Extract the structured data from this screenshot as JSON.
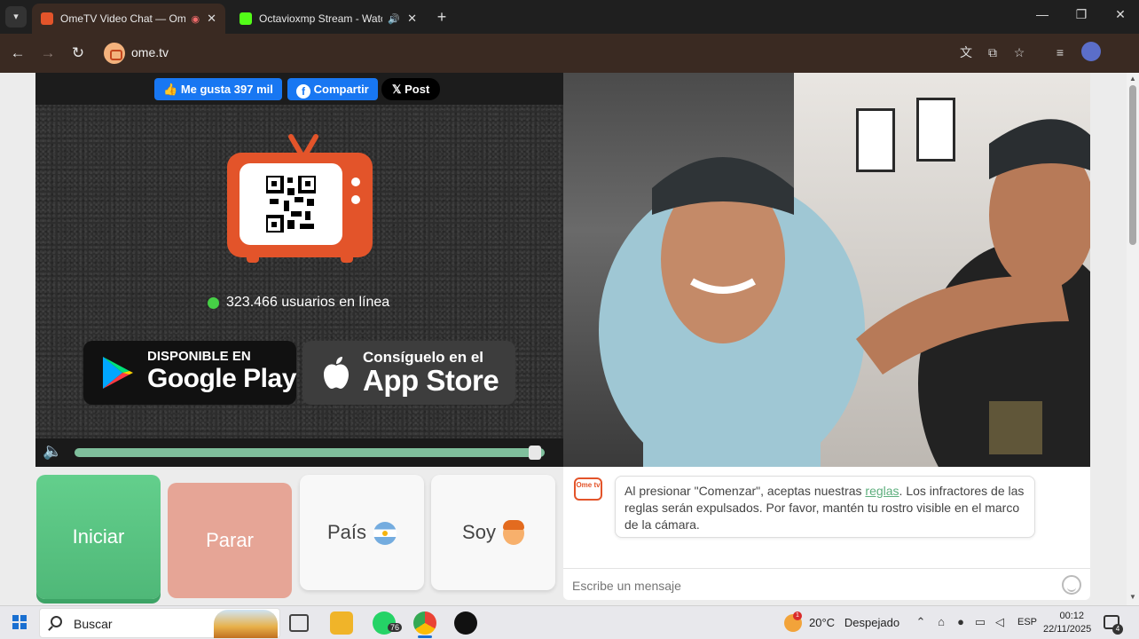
{
  "browser": {
    "tabs": [
      {
        "title": "OmeTV Video Chat — Ome",
        "active": true
      },
      {
        "title": "Octavioxmp Stream - Watc",
        "active": false
      }
    ],
    "url": "ome.tv"
  },
  "share": {
    "like_label": "Me gusta 397 mil",
    "share_label": "Compartir",
    "post_label": "Post"
  },
  "status": {
    "online_text": "323.466 usuarios en línea"
  },
  "stores": {
    "google_small": "DISPONIBLE EN",
    "google_big": "Google Play",
    "apple_small": "Consíguelo en el",
    "apple_big": "App Store"
  },
  "volume": {
    "level": 0.98
  },
  "controls": {
    "start_label": "Iniciar",
    "stop_label": "Parar",
    "country_label": "País",
    "gender_label": "Soy"
  },
  "chat": {
    "logo_text": "Ome tv",
    "message_before_link": "Al presionar \"Comenzar\", aceptas nuestras ",
    "message_link": "reglas",
    "message_after_link": ". Los infractores de las reglas serán expulsados. Por favor, mantén tu rostro visible en el marco de la cámara.",
    "input_placeholder": "Escribe un mensaje"
  },
  "taskbar": {
    "search_text": "Buscar",
    "whatsapp_badge": "76",
    "weather_temp": "20°C",
    "weather_desc": "Despejado",
    "weather_badge": "1",
    "language": "ESP",
    "time": "00:12",
    "date": "22/11/2025",
    "notification_count": "4"
  },
  "colors": {
    "start_green": "#58c282",
    "stop_salmon": "#e6a596",
    "brand_orange": "#e3542a",
    "facebook_blue": "#1877f2"
  }
}
